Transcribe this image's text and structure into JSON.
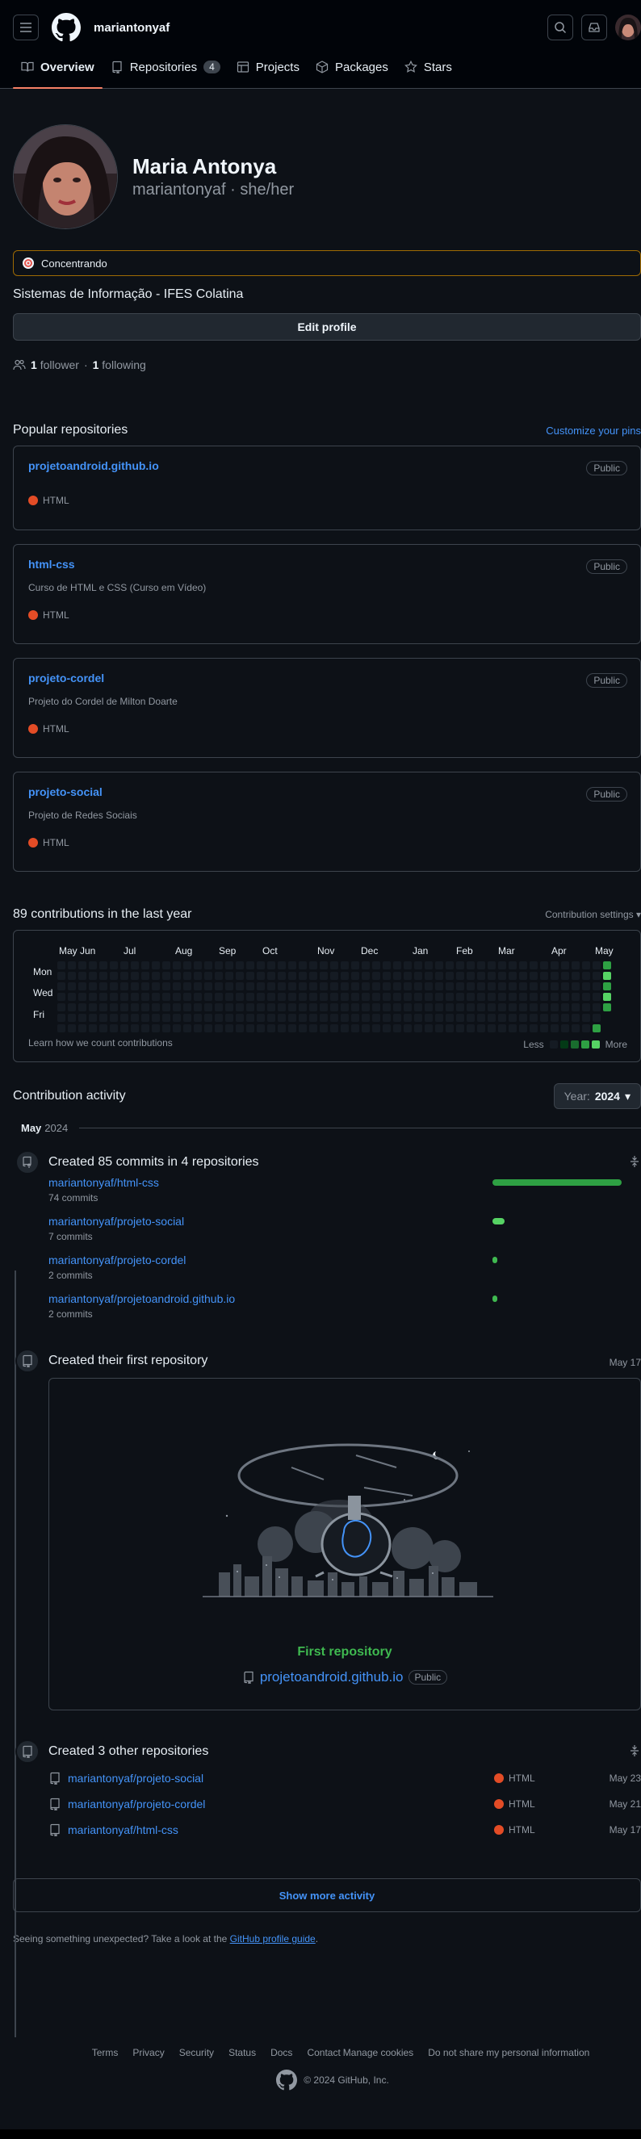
{
  "header": {
    "username": "mariantonyaf"
  },
  "tabs": [
    {
      "label": "Overview",
      "icon": "book-icon"
    },
    {
      "label": "Repositories",
      "icon": "repo-icon",
      "count": "4"
    },
    {
      "label": "Projects",
      "icon": "table-icon"
    },
    {
      "label": "Packages",
      "icon": "package-icon"
    },
    {
      "label": "Stars",
      "icon": "star-icon"
    }
  ],
  "profile": {
    "name": "Maria Antonya",
    "login_line": "mariantonyaf · she/her",
    "status": "Concentrando",
    "bio": "Sistemas de Informação - IFES Colatina",
    "edit_label": "Edit profile",
    "followers": "1",
    "followers_label": "follower",
    "sep": "·",
    "following": "1",
    "following_label": "following"
  },
  "popular": {
    "title": "Popular repositories",
    "customize": "Customize your pins",
    "repos": [
      {
        "name": "projetoandroid.github.io",
        "visibility": "Public",
        "description": "",
        "language": "HTML"
      },
      {
        "name": "html-css",
        "visibility": "Public",
        "description": "Curso de HTML e CSS (Curso em Vídeo)",
        "language": "HTML"
      },
      {
        "name": "projeto-cordel",
        "visibility": "Public",
        "description": "Projeto do Cordel de Milton Doarte",
        "language": "HTML"
      },
      {
        "name": "projeto-social",
        "visibility": "Public",
        "description": "Projeto de Redes Sociais",
        "language": "HTML"
      }
    ]
  },
  "contributions": {
    "title": "89 contributions in the last year",
    "settings": "Contribution settings",
    "months": [
      "May",
      "Jun",
      "Jul",
      "Aug",
      "Sep",
      "Oct",
      "Nov",
      "Dec",
      "Jan",
      "Feb",
      "Mar",
      "Apr",
      "May"
    ],
    "days": [
      "Mon",
      "Wed",
      "Fri"
    ],
    "learn": "Learn how we count contributions",
    "less": "Less",
    "more": "More",
    "colors": [
      "#151b23",
      "#033a16",
      "#196c2e",
      "#2ea043",
      "#56d364"
    ]
  },
  "activity": {
    "title": "Contribution activity",
    "year_label": "Year:",
    "year": "2024",
    "month": "May",
    "month_year": "2024",
    "commits": {
      "title": "Created 85 commits in 4 repositories",
      "items": [
        {
          "repo": "mariantonyaf/html-css",
          "count": "74 commits",
          "value": 74
        },
        {
          "repo": "mariantonyaf/projeto-social",
          "count": "7 commits",
          "value": 7
        },
        {
          "repo": "mariantonyaf/projeto-cordel",
          "count": "2 commits",
          "value": 2
        },
        {
          "repo": "mariantonyaf/projetoandroid.github.io",
          "count": "2 commits",
          "value": 2
        }
      ]
    },
    "first_repo": {
      "title": "Created their first repository",
      "date": "May 17",
      "label": "First repository",
      "repo": "projetoandroid.github.io",
      "visibility": "Public"
    },
    "other_repos": {
      "title": "Created 3 other repositories",
      "items": [
        {
          "repo": "mariantonyaf/projeto-social",
          "language": "HTML",
          "date": "May 23"
        },
        {
          "repo": "mariantonyaf/projeto-cordel",
          "language": "HTML",
          "date": "May 21"
        },
        {
          "repo": "mariantonyaf/html-css",
          "language": "HTML",
          "date": "May 17"
        }
      ]
    },
    "show_more": "Show more activity",
    "unexpected_prefix": "Seeing something unexpected? Take a look at the",
    "unexpected_link": "GitHub profile guide",
    "unexpected_suffix": "."
  },
  "footer": {
    "links": [
      "Terms",
      "Privacy",
      "Security",
      "Status",
      "Docs",
      "Contact",
      "Manage cookies",
      "Do not share my personal information"
    ],
    "copyright": "© 2024 GitHub, Inc."
  }
}
